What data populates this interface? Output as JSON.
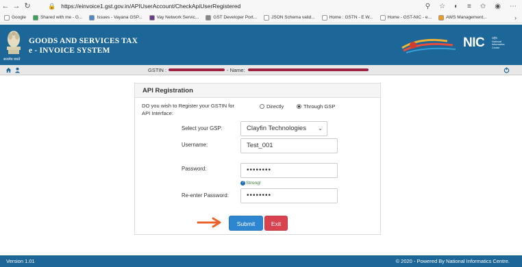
{
  "browser": {
    "url": "https://einvoice1.gst.gov.in/APIUserAccount/CheckApiUserRegistered",
    "bookmarks": [
      {
        "label": "Google",
        "color": "#ffffff"
      },
      {
        "label": "Shared with me - G...",
        "color": "#34a853"
      },
      {
        "label": "Issues - Vayana GSP...",
        "color": "#4a8bd0"
      },
      {
        "label": "Vay Network Servic...",
        "color": "#6a3c8c"
      },
      {
        "label": "GST Developer Port...",
        "color": "#888888"
      },
      {
        "label": "JSON Schema valid...",
        "color": "#ffffff"
      },
      {
        "label": "Home : GSTN - E W...",
        "color": "#ffffff"
      },
      {
        "label": "Home - GST-NIC - e...",
        "color": "#ffffff"
      },
      {
        "label": "AWS Management...",
        "color": "#f19a1a"
      }
    ]
  },
  "header": {
    "title_line1": "GOODS AND SERVICES TAX",
    "title_line2": "e - INVOICE SYSTEM",
    "emblem_caption": "सत्यमेव जयते",
    "nic": "NIC",
    "nic_sub_line1": "राष्ट्रीय",
    "nic_sub_line2": "National",
    "nic_sub_line3": "Informatics",
    "nic_sub_line4": "Centre"
  },
  "info_strip": {
    "gstin_label": "GSTIN :",
    "name_label": "- Name:"
  },
  "panel": {
    "title": "API Registration",
    "question_line1": "DO you wish to Register your GSTIN for",
    "question_line2": "API Interface:",
    "radio_directly": "Directly",
    "radio_gsp": "Through GSP",
    "selected_radio": "Through GSP",
    "gsp_label": "Select your GSP:",
    "gsp_value": "Clayfin Technologies",
    "username_label": "Username:",
    "username_value": "Test_001",
    "password_label": "Password:",
    "password_value": "••••••••",
    "strength": "Strong!",
    "reenter_label": "Re-enter Password:",
    "reenter_value": "••••••••",
    "submit_label": "Submit",
    "exit_label": "Exit"
  },
  "footer": {
    "version": "Version 1.01",
    "powered": "© 2020 - Powered By National Informatics Centre."
  },
  "colors": {
    "header_bg": "#1c6698",
    "submit": "#2e86d0",
    "exit": "#d9434f",
    "annotation_arrow": "#e8622a"
  }
}
